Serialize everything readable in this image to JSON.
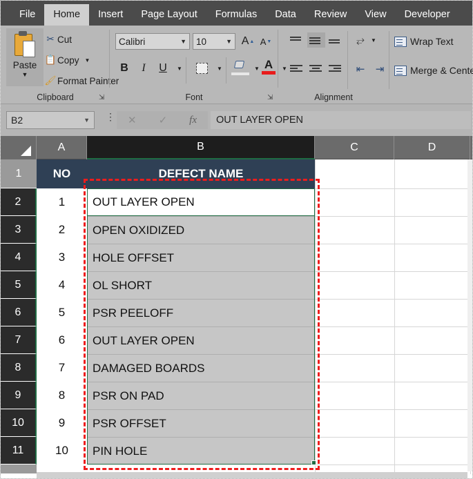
{
  "app": {
    "title": "Microsoft Excel"
  },
  "ribbon_tabs": [
    {
      "label": "File",
      "active": false
    },
    {
      "label": "Home",
      "active": true
    },
    {
      "label": "Insert",
      "active": false
    },
    {
      "label": "Page Layout",
      "active": false
    },
    {
      "label": "Formulas",
      "active": false
    },
    {
      "label": "Data",
      "active": false
    },
    {
      "label": "Review",
      "active": false
    },
    {
      "label": "View",
      "active": false
    },
    {
      "label": "Developer",
      "active": false
    }
  ],
  "clipboard": {
    "group_label": "Clipboard",
    "paste_label": "Paste",
    "cut_label": "Cut",
    "copy_label": "Copy",
    "format_painter_label": "Format Painter"
  },
  "font": {
    "group_label": "Font",
    "family": "Calibri",
    "size": "10",
    "grow_label": "A",
    "shrink_label": "A",
    "bold_label": "B",
    "italic_label": "I",
    "underline_label": "U",
    "font_color_label": "A",
    "font_color_accent": "#e81b1b"
  },
  "alignment": {
    "group_label": "Alignment",
    "wrap_text_label": "Wrap Text",
    "merge_center_label": "Merge & Cente"
  },
  "formula_bar": {
    "name_box": "B2",
    "cancel_label": "✕",
    "enter_label": "✓",
    "fx_label": "fx",
    "content": "OUT LAYER OPEN"
  },
  "sheet": {
    "columns": [
      {
        "label": "A",
        "selected": false
      },
      {
        "label": "B",
        "selected": true
      },
      {
        "label": "C",
        "selected": false
      },
      {
        "label": "D",
        "selected": false
      }
    ],
    "row_headers": [
      {
        "label": "1",
        "selected": false
      },
      {
        "label": "2",
        "selected": true
      },
      {
        "label": "3",
        "selected": true
      },
      {
        "label": "4",
        "selected": true
      },
      {
        "label": "5",
        "selected": true
      },
      {
        "label": "6",
        "selected": true
      },
      {
        "label": "7",
        "selected": true
      },
      {
        "label": "8",
        "selected": true
      },
      {
        "label": "9",
        "selected": true
      },
      {
        "label": "10",
        "selected": true
      },
      {
        "label": "11",
        "selected": true
      }
    ],
    "header_row": {
      "a": "NO",
      "b": "DEFECT NAME"
    },
    "rows": [
      {
        "no": "1",
        "defect": "OUT LAYER OPEN"
      },
      {
        "no": "2",
        "defect": "OPEN OXIDIZED"
      },
      {
        "no": "3",
        "defect": "HOLE OFFSET"
      },
      {
        "no": "4",
        "defect": "OL SHORT"
      },
      {
        "no": "5",
        "defect": "PSR PEELOFF"
      },
      {
        "no": "6",
        "defect": "OUT LAYER OPEN"
      },
      {
        "no": "7",
        "defect": "DAMAGED BOARDS"
      },
      {
        "no": "8",
        "defect": "PSR ON PAD"
      },
      {
        "no": "9",
        "defect": "PSR OFFSET"
      },
      {
        "no": "10",
        "defect": "PIN HOLE"
      }
    ],
    "header_fill_color": "#2f4055",
    "selection_border_color": "#1e6b43",
    "selection_fill_color": "#c6c6c6",
    "annotation_color": "#ee1c1c"
  }
}
